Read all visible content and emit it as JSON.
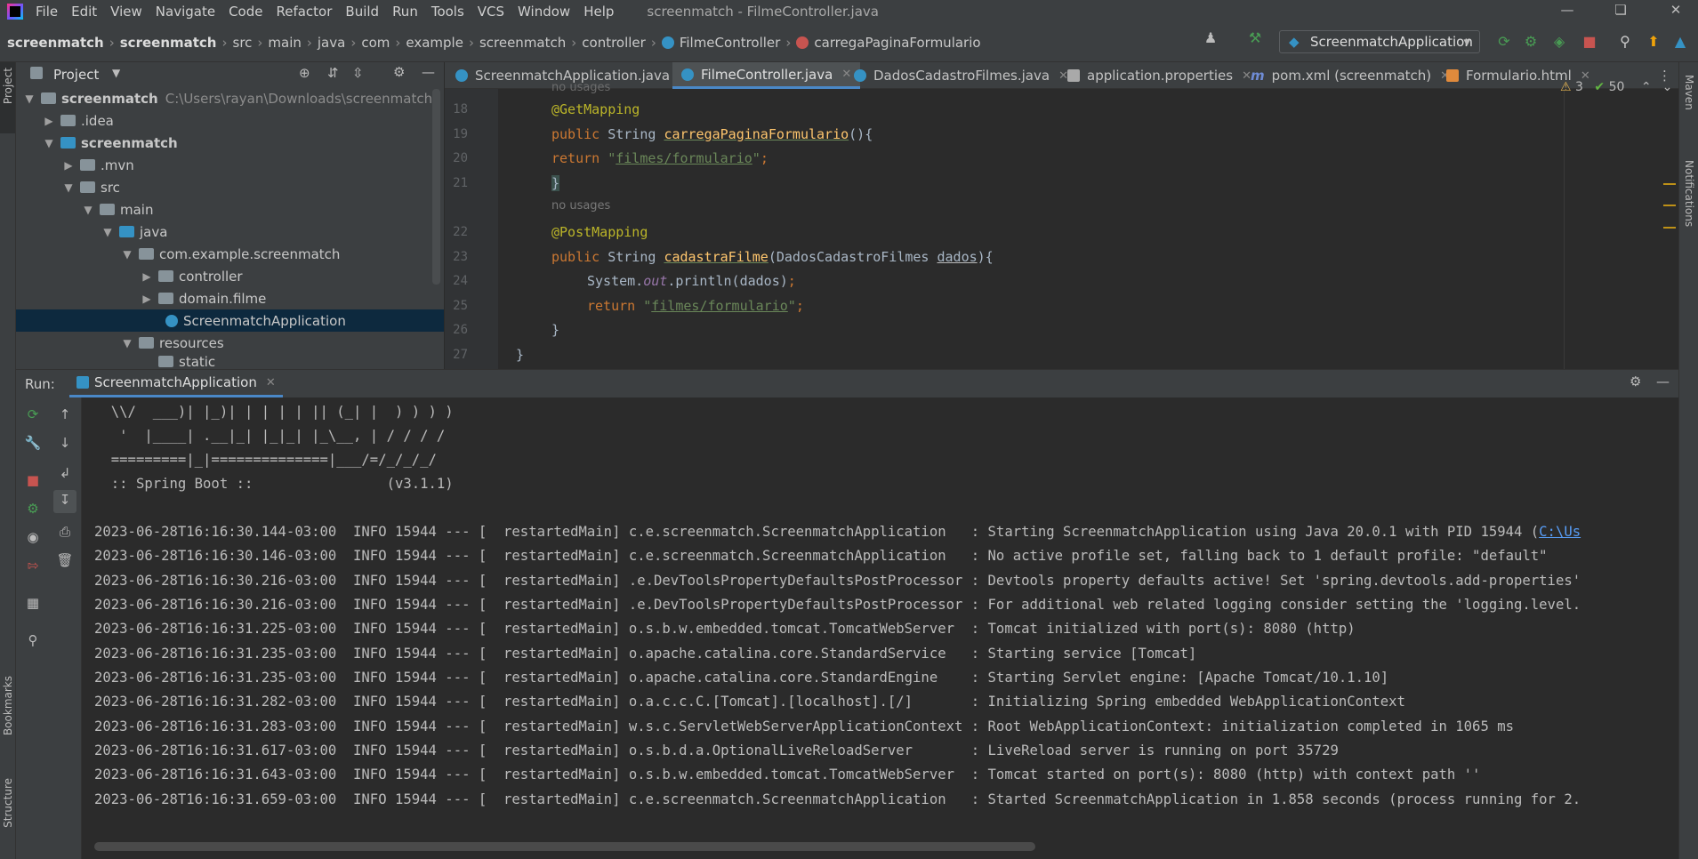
{
  "window": {
    "title": "screenmatch - FilmeController.java",
    "logo_icon": "intellij-logo-icon"
  },
  "menu": [
    "File",
    "Edit",
    "View",
    "Navigate",
    "Code",
    "Refactor",
    "Build",
    "Run",
    "Tools",
    "VCS",
    "Window",
    "Help"
  ],
  "breadcrumb": [
    "screenmatch",
    "screenmatch",
    "src",
    "main",
    "java",
    "com",
    "example",
    "screenmatch",
    "controller",
    "FilmeController",
    "carregaPaginaFormulario"
  ],
  "run_config": "ScreenmatchApplication",
  "project_panel": {
    "title": "Project",
    "tree": [
      {
        "label": "screenmatch",
        "path": "C:\\Users\\rayan\\Downloads\\screenmatch",
        "expanded": true
      },
      {
        "label": ".idea",
        "expanded": false
      },
      {
        "label": "screenmatch",
        "expanded": true
      },
      {
        "label": ".mvn",
        "expanded": false
      },
      {
        "label": "src",
        "expanded": true
      },
      {
        "label": "main",
        "expanded": true
      },
      {
        "label": "java",
        "expanded": true
      },
      {
        "label": "com.example.screenmatch",
        "expanded": true
      },
      {
        "label": "controller",
        "expanded": false
      },
      {
        "label": "domain.filme",
        "expanded": false
      },
      {
        "label": "ScreenmatchApplication",
        "selected": true
      },
      {
        "label": "resources",
        "expanded": true
      },
      {
        "label": "static",
        "expanded": false
      }
    ]
  },
  "tabs": [
    {
      "label": "ScreenmatchApplication.java",
      "active": false
    },
    {
      "label": "FilmeController.java",
      "active": true
    },
    {
      "label": "DadosCadastroFilmes.java",
      "active": false
    },
    {
      "label": "application.properties",
      "active": false
    },
    {
      "label": "pom.xml (screenmatch)",
      "active": false
    },
    {
      "label": "Formulario.html",
      "active": false
    }
  ],
  "inspections": {
    "warnings": "3",
    "ok": "50"
  },
  "editor": {
    "lines": [
      {
        "n": "18",
        "text": "@GetMapping"
      },
      {
        "n": "19",
        "text": "public String carregaPaginaFormulario(){"
      },
      {
        "n": "20",
        "text": "return \"filmes/formulario\";"
      },
      {
        "n": "21",
        "text": "}"
      },
      {
        "hint": "no usages"
      },
      {
        "n": "22",
        "text": "@PostMapping"
      },
      {
        "n": "23",
        "text": "public String cadastraFilme(DadosCadastroFilmes dados){"
      },
      {
        "n": "24",
        "text": "System.out.println(dados);"
      },
      {
        "n": "25",
        "text": "return \"filmes/formulario\";"
      },
      {
        "n": "26",
        "text": "}"
      },
      {
        "n": "27",
        "text": "}"
      }
    ],
    "top_hint": "no usages"
  },
  "run_panel": {
    "label": "Run:",
    "tab": "ScreenmatchApplication"
  },
  "console": {
    "banner": [
      "  \\\\/  ___)| |_)| | | | | || (_| |  ) ) ) )",
      "   '  |____| .__|_| |_|_| |_\\__, | / / / /",
      "  =========|_|==============|___/=/_/_/_/",
      "  :: Spring Boot ::                (v3.1.1)"
    ],
    "logs": [
      "2023-06-28T16:16:30.144-03:00  INFO 15944 --- [  restartedMain] c.e.screenmatch.ScreenmatchApplication   : Starting ScreenmatchApplication using Java 20.0.1 with PID 15944 (",
      "2023-06-28T16:16:30.146-03:00  INFO 15944 --- [  restartedMain] c.e.screenmatch.ScreenmatchApplication   : No active profile set, falling back to 1 default profile: \"default\"",
      "2023-06-28T16:16:30.216-03:00  INFO 15944 --- [  restartedMain] .e.DevToolsPropertyDefaultsPostProcessor : Devtools property defaults active! Set 'spring.devtools.add-properties'",
      "2023-06-28T16:16:30.216-03:00  INFO 15944 --- [  restartedMain] .e.DevToolsPropertyDefaultsPostProcessor : For additional web related logging consider setting the 'logging.level.",
      "2023-06-28T16:16:31.225-03:00  INFO 15944 --- [  restartedMain] o.s.b.w.embedded.tomcat.TomcatWebServer  : Tomcat initialized with port(s): 8080 (http)",
      "2023-06-28T16:16:31.235-03:00  INFO 15944 --- [  restartedMain] o.apache.catalina.core.StandardService   : Starting service [Tomcat]",
      "2023-06-28T16:16:31.235-03:00  INFO 15944 --- [  restartedMain] o.apache.catalina.core.StandardEngine    : Starting Servlet engine: [Apache Tomcat/10.1.10]",
      "2023-06-28T16:16:31.282-03:00  INFO 15944 --- [  restartedMain] o.a.c.c.C.[Tomcat].[localhost].[/]       : Initializing Spring embedded WebApplicationContext",
      "2023-06-28T16:16:31.283-03:00  INFO 15944 --- [  restartedMain] w.s.c.ServletWebServerApplicationContext : Root WebApplicationContext: initialization completed in 1065 ms",
      "2023-06-28T16:16:31.617-03:00  INFO 15944 --- [  restartedMain] o.s.b.d.a.OptionalLiveReloadServer       : LiveReload server is running on port 35729",
      "2023-06-28T16:16:31.643-03:00  INFO 15944 --- [  restartedMain] o.s.b.w.embedded.tomcat.TomcatWebServer  : Tomcat started on port(s): 8080 (http) with context path ''",
      "2023-06-28T16:16:31.659-03:00  INFO 15944 --- [  restartedMain] c.e.screenmatch.ScreenmatchApplication   : Started ScreenmatchApplication in 1.858 seconds (process running for 2."
    ],
    "first_line_link": "C:\\Us"
  },
  "side_labels": {
    "project": "Project",
    "bookmarks": "Bookmarks",
    "structure": "Structure",
    "maven": "Maven",
    "notifications": "Notifications"
  },
  "colors": {
    "accent": "#4a88c7",
    "selection": "#0d293e",
    "stop": "#c75450",
    "run": "#499c54"
  }
}
